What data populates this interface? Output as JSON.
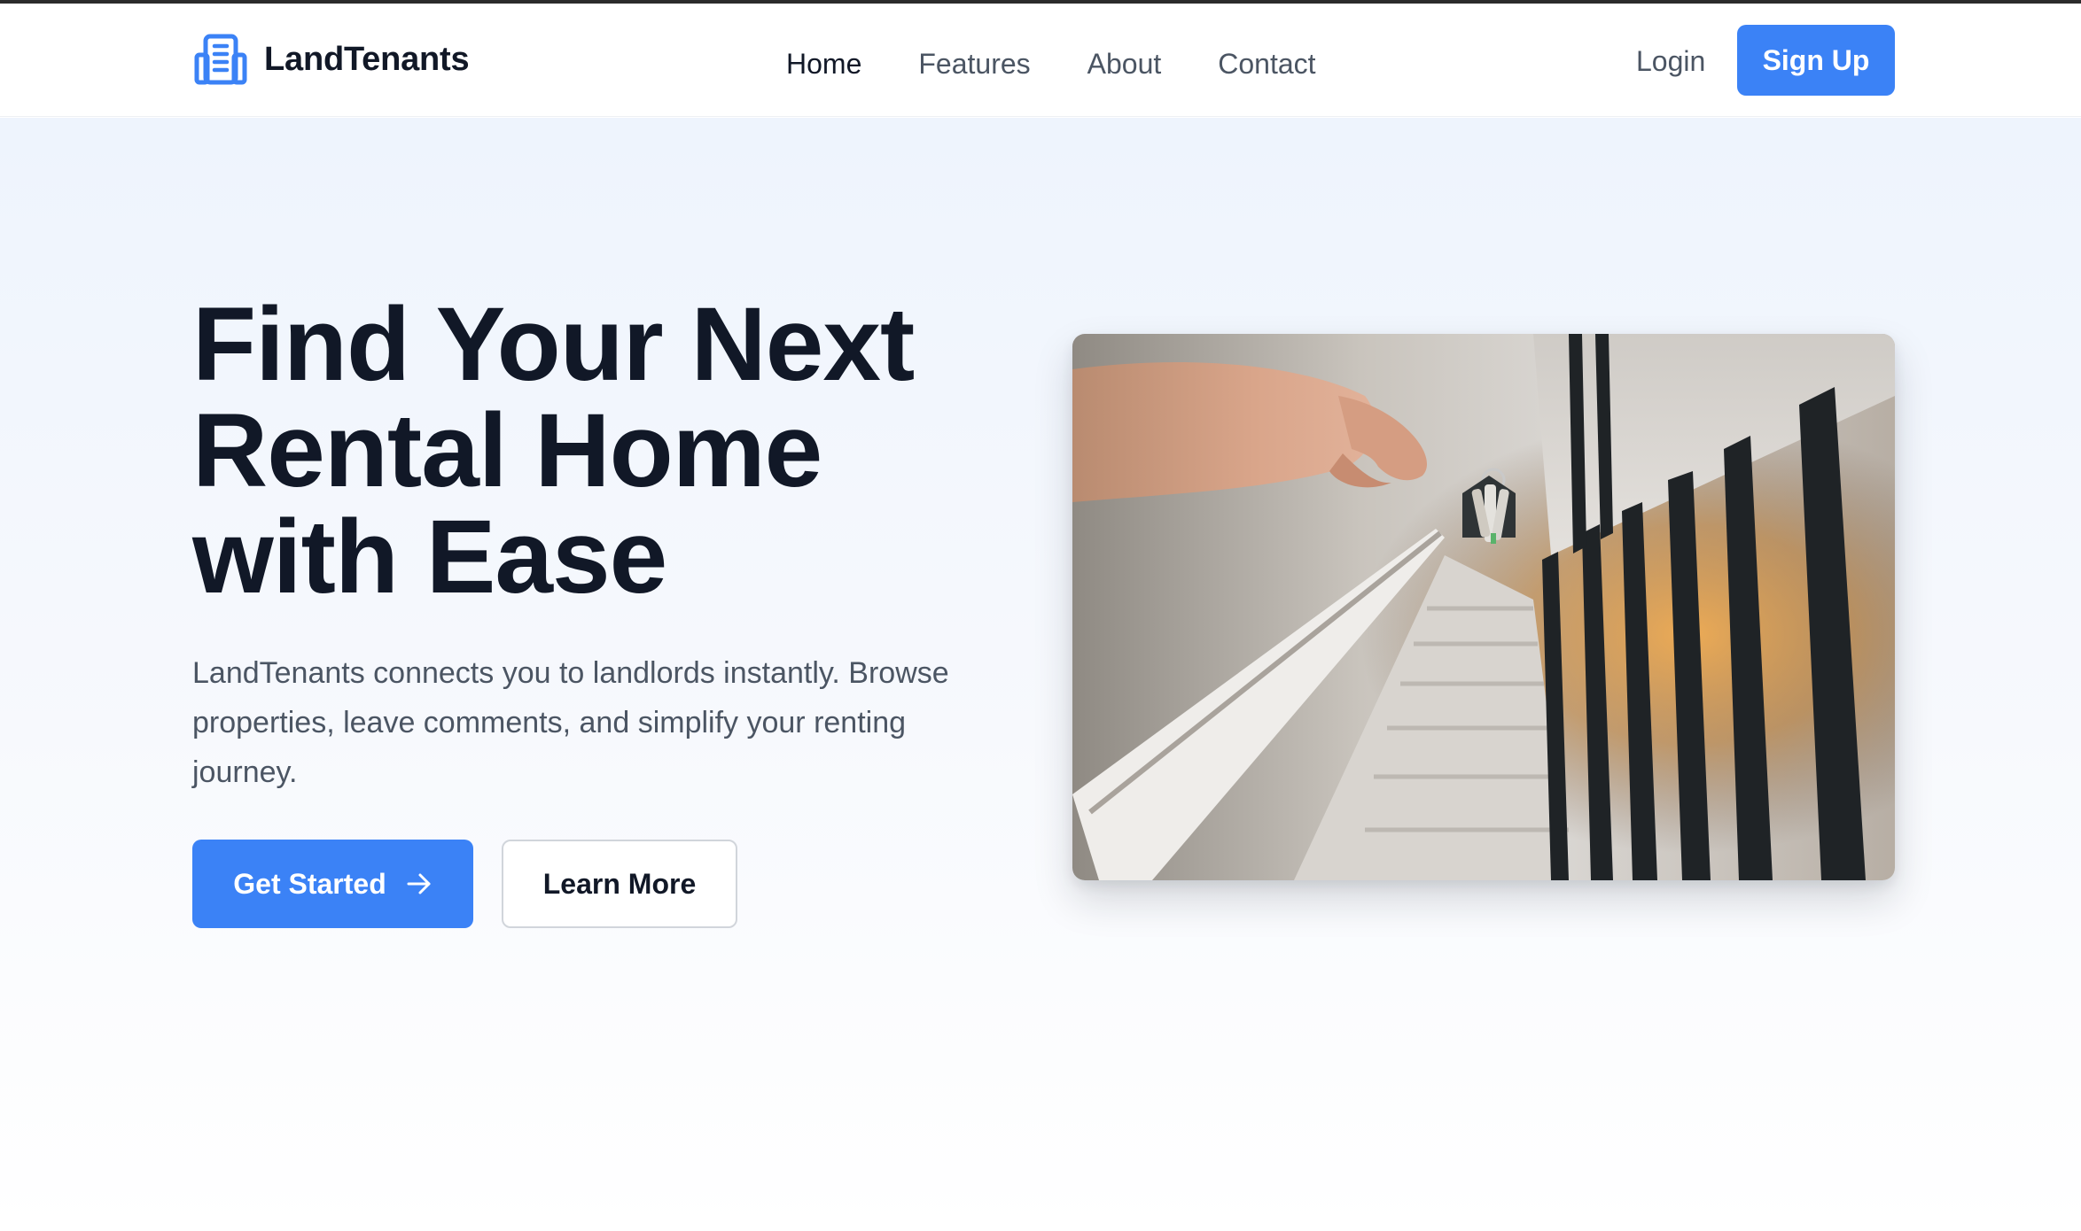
{
  "header": {
    "brand": "LandTenants",
    "brand_icon": "building-icon",
    "nav": [
      {
        "label": "Home",
        "active": true
      },
      {
        "label": "Features",
        "active": false
      },
      {
        "label": "About",
        "active": false
      },
      {
        "label": "Contact",
        "active": false
      }
    ],
    "login_label": "Login",
    "signup_label": "Sign Up"
  },
  "hero": {
    "title_lines": [
      "Find Your Next",
      "Rental Home",
      "with Ease"
    ],
    "description": "LandTenants connects you to landlords instantly. Browse properties, leave comments, and simplify your renting journey.",
    "primary_cta": "Get Started",
    "primary_cta_icon": "arrow-right-icon",
    "secondary_cta": "Learn More"
  },
  "colors": {
    "accent": "#3b82f6",
    "heading": "#111827",
    "body_text": "#4b5563"
  }
}
